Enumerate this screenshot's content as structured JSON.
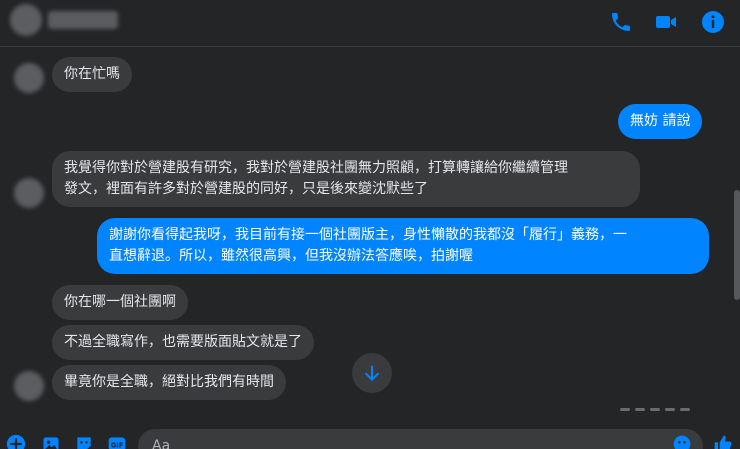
{
  "header": {
    "call_icon": "phone-icon",
    "video_icon": "video-camera-icon",
    "info_icon": "info-icon",
    "accent_color": "#0084ff"
  },
  "messages": [
    {
      "side": "received",
      "text": "你在忙嗎"
    },
    {
      "side": "sent",
      "text": "無妨 請說"
    },
    {
      "side": "received",
      "text": "我覺得你對於營建股有研究，我對於營建股社團無力照顧，打算轉讓給你繼續管理\n發文，裡面有許多對於營建股的同好，只是後來變沈默些了"
    },
    {
      "side": "sent",
      "text": "謝謝你看得起我呀，我目前有接一個社團版主，身性懶散的我都沒「履行」義務，一\n直想辭退。所以，雖然很高興，但我沒辦法答應唉，拍謝喔"
    },
    {
      "side": "received",
      "text": "你在哪一個社團啊"
    },
    {
      "side": "received",
      "text": "不過全職寫作，也需要版面貼文就是了"
    },
    {
      "side": "received",
      "text": "畢竟你是全職，絕對比我們有時間"
    }
  ],
  "composer": {
    "placeholder": "Aa",
    "icons": [
      "plus-circle-icon",
      "photo-icon",
      "sticker-icon",
      "gif-icon",
      "emoji-icon",
      "like-icon"
    ]
  },
  "colors": {
    "background": "#242526",
    "received_bubble": "#3a3b3c",
    "sent_bubble": "#0084ff"
  }
}
